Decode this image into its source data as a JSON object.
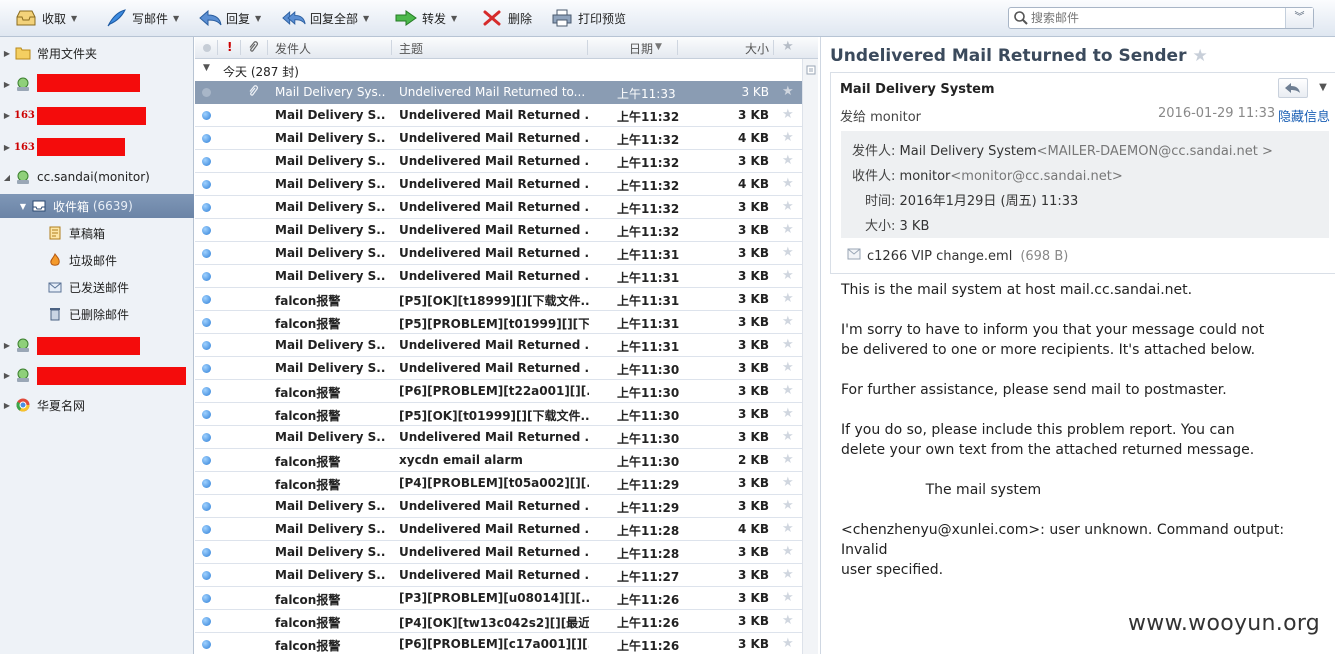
{
  "toolbar": {
    "receive": "收取",
    "compose": "写邮件",
    "reply": "回复",
    "reply_all": "回复全部",
    "forward": "转发",
    "delete": "删除",
    "print_preview": "打印预览",
    "search_placeholder": "搜索邮件"
  },
  "sidebar": {
    "common_folders": "常用文件夹",
    "account_monitor": "cc.sandai(monitor)",
    "inbox": "收件箱",
    "inbox_count": "(6639)",
    "drafts": "草稿箱",
    "junk": "垃圾邮件",
    "sent": "已发送邮件",
    "deleted": "已删除邮件",
    "account_huaxia": "华夏名网",
    "tag163": "163"
  },
  "list": {
    "header": {
      "from": "发件人",
      "subject": "主题",
      "date": "日期",
      "size": "大小"
    },
    "group_label": "今天 (287 封)",
    "rows": [
      {
        "from": "Mail Delivery Sys...",
        "subject": "Undelivered Mail Returned to...",
        "date": "上午11:33",
        "size": "3 KB",
        "bold": false,
        "selected": true,
        "attach": true
      },
      {
        "from": "Mail Delivery S...",
        "subject": "Undelivered Mail Returned ...",
        "date": "上午11:32",
        "size": "3 KB",
        "bold": true
      },
      {
        "from": "Mail Delivery S...",
        "subject": "Undelivered Mail Returned ...",
        "date": "上午11:32",
        "size": "4 KB",
        "bold": true
      },
      {
        "from": "Mail Delivery S...",
        "subject": "Undelivered Mail Returned ...",
        "date": "上午11:32",
        "size": "3 KB",
        "bold": true
      },
      {
        "from": "Mail Delivery S...",
        "subject": "Undelivered Mail Returned ...",
        "date": "上午11:32",
        "size": "4 KB",
        "bold": true
      },
      {
        "from": "Mail Delivery S...",
        "subject": "Undelivered Mail Returned ...",
        "date": "上午11:32",
        "size": "3 KB",
        "bold": true
      },
      {
        "from": "Mail Delivery S...",
        "subject": "Undelivered Mail Returned ...",
        "date": "上午11:32",
        "size": "3 KB",
        "bold": true
      },
      {
        "from": "Mail Delivery S...",
        "subject": "Undelivered Mail Returned ...",
        "date": "上午11:31",
        "size": "3 KB",
        "bold": true
      },
      {
        "from": "Mail Delivery S...",
        "subject": "Undelivered Mail Returned ...",
        "date": "上午11:31",
        "size": "3 KB",
        "bold": true
      },
      {
        "from": "falcon报警",
        "subject": "[P5][OK][t18999][][下载文件...",
        "date": "上午11:31",
        "size": "3 KB",
        "bold": true
      },
      {
        "from": "falcon报警",
        "subject": "[P5][PROBLEM][t01999][][下...",
        "date": "上午11:31",
        "size": "3 KB",
        "bold": true
      },
      {
        "from": "Mail Delivery S...",
        "subject": "Undelivered Mail Returned ...",
        "date": "上午11:31",
        "size": "3 KB",
        "bold": true
      },
      {
        "from": "Mail Delivery S...",
        "subject": "Undelivered Mail Returned ...",
        "date": "上午11:30",
        "size": "3 KB",
        "bold": true
      },
      {
        "from": "falcon报警",
        "subject": "[P6][PROBLEM][t22a001][][...",
        "date": "上午11:30",
        "size": "3 KB",
        "bold": true
      },
      {
        "from": "falcon报警",
        "subject": "[P5][OK][t01999][][下载文件...",
        "date": "上午11:30",
        "size": "3 KB",
        "bold": true
      },
      {
        "from": "Mail Delivery S...",
        "subject": "Undelivered Mail Returned ...",
        "date": "上午11:30",
        "size": "3 KB",
        "bold": true
      },
      {
        "from": "falcon报警",
        "subject": "xycdn email alarm",
        "date": "上午11:30",
        "size": "2 KB",
        "bold": true
      },
      {
        "from": "falcon报警",
        "subject": "[P4][PROBLEM][t05a002][][...",
        "date": "上午11:29",
        "size": "3 KB",
        "bold": true
      },
      {
        "from": "Mail Delivery S...",
        "subject": "Undelivered Mail Returned ...",
        "date": "上午11:29",
        "size": "3 KB",
        "bold": true
      },
      {
        "from": "Mail Delivery S...",
        "subject": "Undelivered Mail Returned ...",
        "date": "上午11:28",
        "size": "4 KB",
        "bold": true
      },
      {
        "from": "Mail Delivery S...",
        "subject": "Undelivered Mail Returned ...",
        "date": "上午11:28",
        "size": "3 KB",
        "bold": true
      },
      {
        "from": "Mail Delivery S...",
        "subject": "Undelivered Mail Returned ...",
        "date": "上午11:27",
        "size": "3 KB",
        "bold": true
      },
      {
        "from": "falcon报警",
        "subject": "[P3][PROBLEM][u08014][][...",
        "date": "上午11:26",
        "size": "3 KB",
        "bold": true
      },
      {
        "from": "falcon报警",
        "subject": "[P4][OK][tw13c042s2][][最近...",
        "date": "上午11:26",
        "size": "3 KB",
        "bold": true
      },
      {
        "from": "falcon报警",
        "subject": "[P6][PROBLEM][c17a001][][...",
        "date": "上午11:26",
        "size": "3 KB",
        "bold": true
      }
    ]
  },
  "preview": {
    "title": "Undelivered Mail Returned to Sender",
    "sender_name": "Mail Delivery System",
    "to_line": "发给 monitor",
    "date": "2016-01-29 11:33",
    "hide_info": "隐藏信息",
    "from_label": "发件人:",
    "from_name": "Mail Delivery System",
    "from_addr": "<MAILER-DAEMON@cc.sandai.net >",
    "to_label": "收件人:",
    "to_name": "monitor",
    "to_addr": "<monitor@cc.sandai.net>",
    "time_label": "时间:",
    "time_value": "2016年1月29日 (周五) 11:33",
    "size_label": "大小:",
    "size_value": "3 KB",
    "attachment_name": "c1266 VIP change.eml",
    "attachment_size": "(698 B)",
    "body": [
      "This is the mail system at host mail.cc.sandai.net.",
      "I'm sorry to have to inform you that your message could not\nbe delivered to one or more recipients. It's attached below.",
      "For further assistance, please send mail to postmaster.",
      "If you do so, please include this problem report. You can\ndelete your own text from the attached returned message.",
      "                   The mail system",
      "<chenzhenyu@xunlei.com>: user unknown. Command output: Invalid\nuser specified."
    ]
  },
  "watermark": "www.wooyun.org"
}
